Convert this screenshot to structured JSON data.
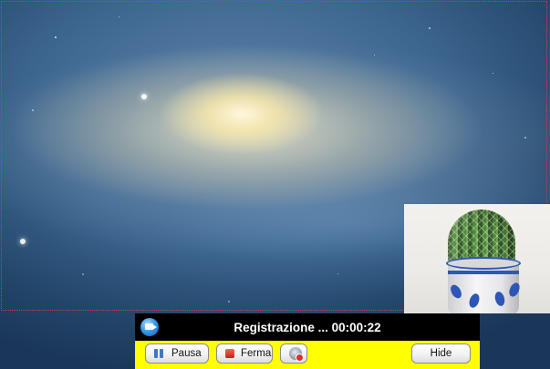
{
  "recording_bar": {
    "status_text": "Registrazione ... 00:00:22",
    "pause_label": "Pausa",
    "stop_label": "Ferma",
    "hide_label": "Hide"
  },
  "icons": {
    "app": "screen-recorder-icon",
    "pause": "pause-icon",
    "stop": "stop-icon",
    "webcam_toggle": "webcam-off-icon"
  },
  "colors": {
    "bar_background": "#ffff00",
    "title_background": "#000000",
    "selection_border": "#d04040"
  }
}
